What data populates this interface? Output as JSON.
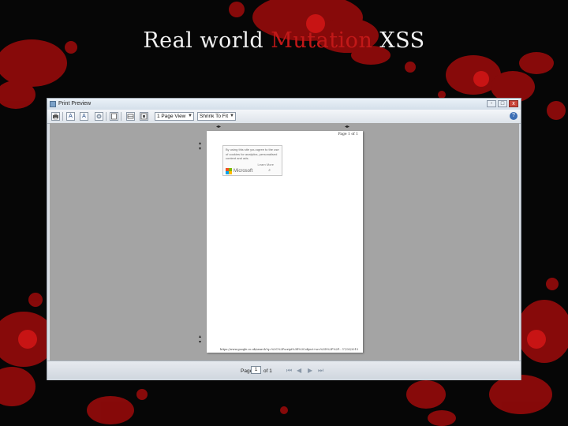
{
  "slide": {
    "title_main": "Real world ",
    "title_accent": "Mutation",
    "title_end": " XSS",
    "accent_color": "#c21818"
  },
  "window": {
    "title": "Print Preview",
    "close_glyph": "x",
    "min_glyph": "-",
    "max_glyph": "□"
  },
  "toolbar": {
    "print_icon": "printer-icon",
    "view_select": "1 Page View",
    "shrink_select": "Shrink To Fit",
    "help_glyph": "?",
    "font_a": "A"
  },
  "page": {
    "header": "Page 1 of 1",
    "cookie_text": "By using this site you agree to the use of cookies for analytics, personalised content and ads.",
    "learn_more": "Learn More",
    "brand": "Microsoft",
    "footer_url": "https://www.google.co.uk/search?q=%3C%2Fscript%3E%3Cobject+src%3D%2F%2F...",
    "footer_date": "17/03/2015"
  },
  "status": {
    "page_label": "Page",
    "page_value": "1",
    "of_label": "of 1"
  }
}
